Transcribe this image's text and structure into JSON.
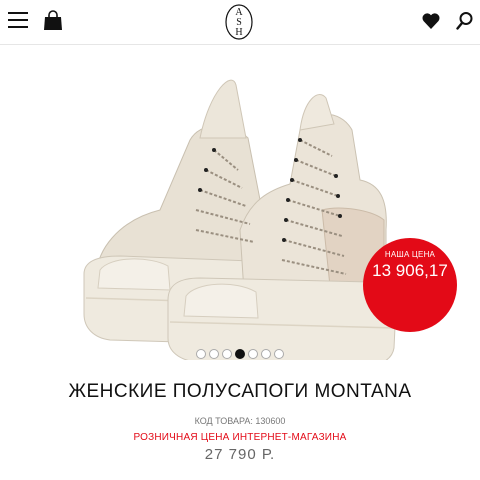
{
  "header": {
    "logo_text": "ASH",
    "icons": [
      "menu-icon",
      "bag-icon",
      "heart-icon",
      "search-icon"
    ]
  },
  "product": {
    "title": "ЖЕНСКИЕ ПОЛУСАПОГИ MONTANA",
    "sku": "КОД ТОВАРА: 130600",
    "retail_label": "РОЗНИЧНАЯ ЦЕНА ИНТЕРНЕТ-МАГАЗИНА",
    "retail_price": "27 790 Р.",
    "badge": {
      "label": "НАША ЦЕНА",
      "price": "13 906,17"
    },
    "image_description_icon": "sneaker-boots-image"
  },
  "gallery": {
    "dot_count": 7,
    "active_index": 3
  },
  "colors": {
    "accent_red": "#e30a17",
    "text_dark": "#111111",
    "text_muted": "#777777"
  }
}
